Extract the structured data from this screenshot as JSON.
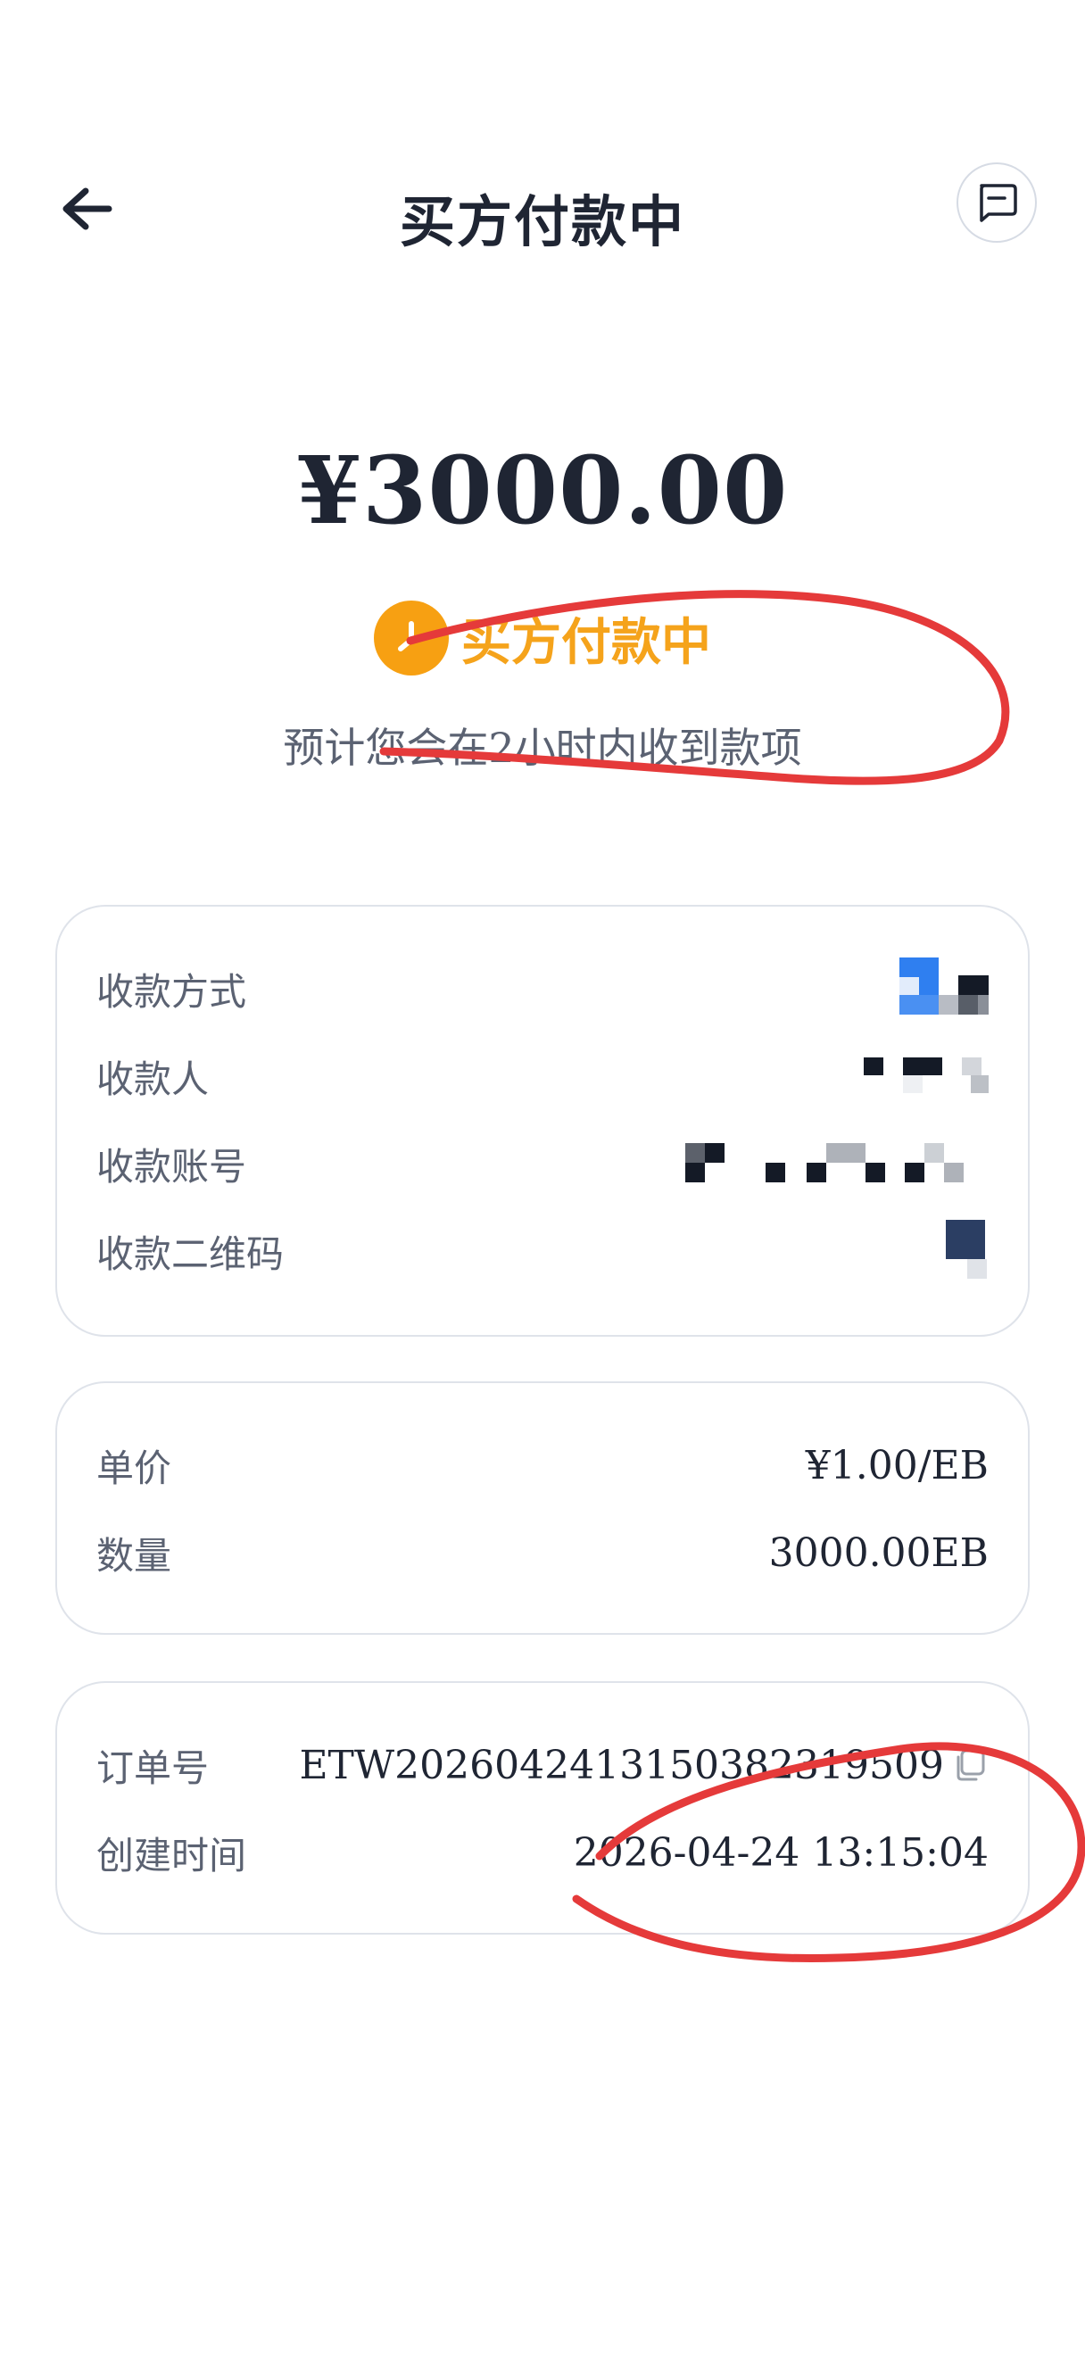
{
  "header": {
    "title": "买方付款中",
    "back_icon": "arrow-left-icon",
    "chat_icon": "message-icon"
  },
  "summary": {
    "amount": "¥3000.00",
    "status": "买方付款中",
    "status_icon": "clock-icon",
    "status_color": "#f5a31b",
    "note": "预计您会在2小时内收到款项"
  },
  "payment": {
    "method_label": "收款方式",
    "payee_label": "收款人",
    "account_label": "收款账号",
    "qrcode_label": "收款二维码",
    "values_state": "pixelated"
  },
  "price": {
    "unit_price_label": "单价",
    "unit_price_value": "¥1.00/EB",
    "quantity_label": "数量",
    "quantity_value": "3000.00EB"
  },
  "order": {
    "order_no_label": "订单号",
    "order_no_value": "ETW20260424131503823195​09",
    "copy_icon": "copy-icon",
    "created_label": "创建时间",
    "created_value": "2026-04-24 13:15:04"
  },
  "colors": {
    "accent_orange": "#f7a012",
    "annotation_red": "#e53a3a",
    "card_border": "#dfe3ea"
  }
}
